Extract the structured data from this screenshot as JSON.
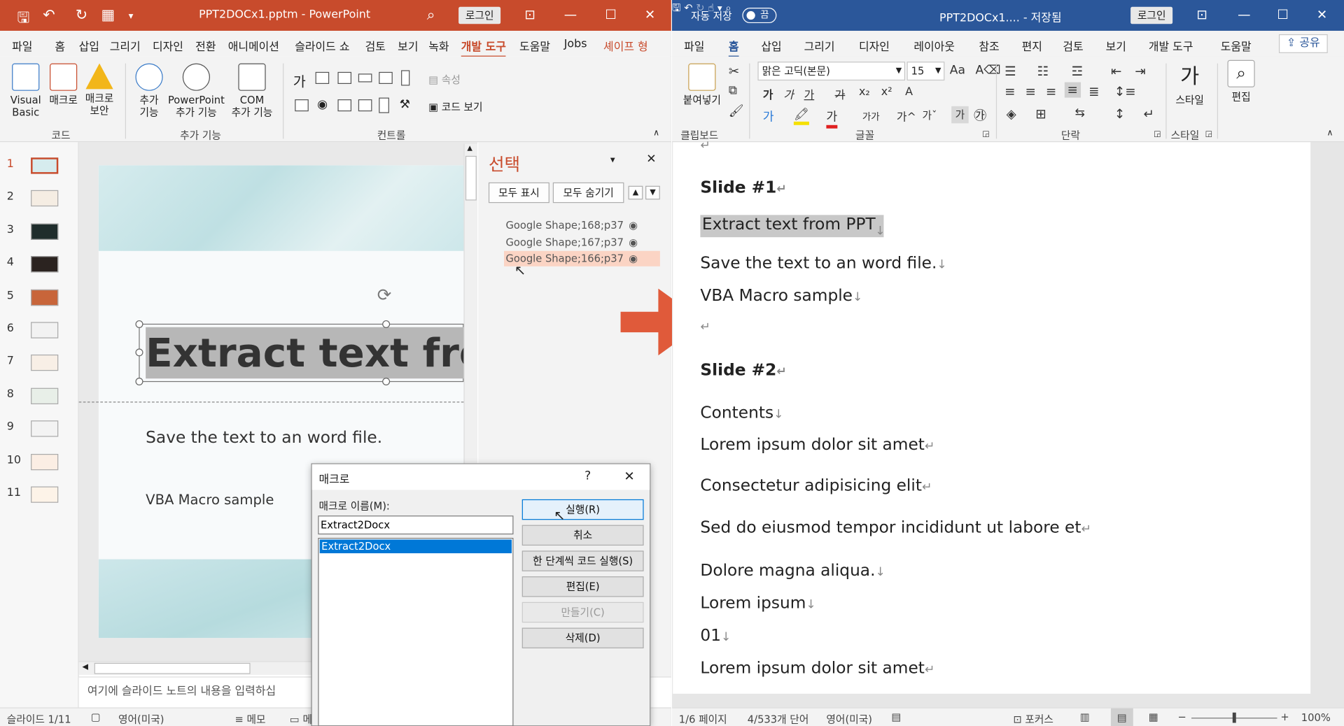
{
  "ppt": {
    "title": "PPT2DOCx1.pptm  -  PowerPoint",
    "login": "로그인",
    "tabs": [
      "파일",
      "홈",
      "삽입",
      "그리기",
      "디자인",
      "전환",
      "애니메이션",
      "슬라이드 쇼",
      "검토",
      "보기",
      "녹화",
      "개발 도구",
      "도움말",
      "Jobs",
      "셰이프 형"
    ],
    "ribbon": {
      "vba": "Visual\nBasic",
      "macro": "매크로",
      "macro_security": "매크로\n보안",
      "addins": "추가\n기능",
      "ppt_addins": "PowerPoint\n추가 기능",
      "com_addins": "COM\n추가 기능",
      "properties": "속성",
      "view_code": "코드 보기",
      "group_code": "코드",
      "group_addins": "추가 기능",
      "group_controls": "컨트롤"
    },
    "slide_numbers": [
      "1",
      "2",
      "3",
      "4",
      "5",
      "6",
      "7",
      "8",
      "9",
      "10",
      "11"
    ],
    "slide": {
      "title": "Extract text from PPT",
      "line1": "Save the text to an word file.",
      "line2": "VBA Macro sample"
    },
    "selection_pane": {
      "title": "선택",
      "show_all": "모두 표시",
      "hide_all": "모두 숨기기",
      "items": [
        "Google Shape;168;p37",
        "Google Shape;167;p37",
        "Google Shape;166;p37"
      ]
    },
    "notes_placeholder": "여기에 슬라이드 노트의 내용을 입력하십",
    "status": {
      "slide": "슬라이드 1/11",
      "lang": "영어(미국)",
      "memo": "메모",
      "comments": "메"
    }
  },
  "macro_dialog": {
    "title": "매크로",
    "help": "?",
    "name_label": "매크로 이름(M):",
    "name_value": "Extract2Docx",
    "list": [
      "Extract2Docx"
    ],
    "buttons": [
      "실행(R)",
      "취소",
      "한 단계씩 코드 실행(S)",
      "편집(E)",
      "만들기(C)",
      "삭제(D)"
    ]
  },
  "word": {
    "autosave": "자동 저장",
    "toggle": "끔",
    "title": "PPT2DOCx1....  -  저장됨",
    "login": "로그인",
    "share": "공유",
    "tabs": [
      "파일",
      "홈",
      "삽입",
      "그리기",
      "디자인",
      "레이아웃",
      "참조",
      "편지",
      "검토",
      "보기",
      "개발 도구",
      "도움말"
    ],
    "ribbon": {
      "paste": "붙여넣기",
      "font": "맑은 고딕(본문)",
      "size": "15",
      "styles": "스타일",
      "edit": "편집",
      "group_clipboard": "클립보드",
      "group_font": "글꼴",
      "group_paragraph": "단락",
      "group_styles": "스타일"
    },
    "doc": {
      "slide1": "Slide #1",
      "l1": "Extract text from PPT",
      "l2": "Save the text to an word file.",
      "l3": "VBA Macro sample",
      "slide2": "Slide #2",
      "p1": "Contents",
      "p2": "Lorem ipsum dolor sit amet",
      "p3": "Consectetur adipisicing elit",
      "p4": "Sed do eiusmod tempor incididunt ut labore et",
      "p5": "Dolore magna aliqua.",
      "p6": "Lorem ipsum",
      "p7": "01",
      "p8": "Lorem ipsum dolor sit amet"
    },
    "status": {
      "page": "1/6 페이지",
      "words": "4/533개 단어",
      "lang": "영어(미국)",
      "focus": "포커스",
      "zoom": "100%"
    }
  },
  "colors": {
    "ppt_accent": "#c84b2c",
    "word_accent": "#2b579a",
    "arrow": "#e05a3a",
    "selection": "#fbd4c4"
  }
}
